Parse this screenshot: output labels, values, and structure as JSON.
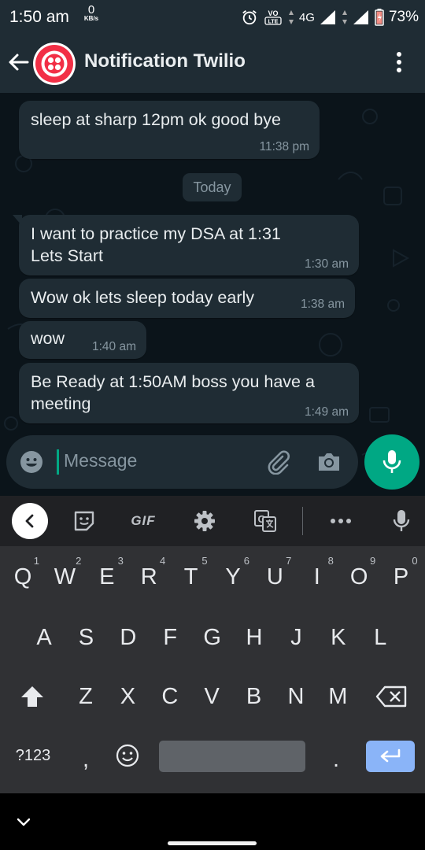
{
  "status_bar": {
    "time": "1:50 am",
    "net_speed_value": "0",
    "net_speed_unit": "KB/s",
    "network": "4G",
    "battery": "73%"
  },
  "header": {
    "title": "Notification Twilio"
  },
  "messages": [
    {
      "text": "sleep at sharp 12pm ok good bye",
      "time": "11:38 pm"
    },
    {
      "text": "I want to practice my DSA at 1:31",
      "text2": "Lets Start",
      "time": "1:30 am"
    },
    {
      "text": "Wow ok lets sleep today early",
      "time": "1:38 am"
    },
    {
      "text": "wow",
      "time": "1:40 am"
    },
    {
      "text": "Be Ready at 1:50AM boss you have a",
      "text2": "meeting",
      "time": "1:49 am"
    }
  ],
  "date_divider": "Today",
  "composer": {
    "placeholder": "Message"
  },
  "keyboard_toolbar": {
    "gif_label": "GIF"
  },
  "keyboard": {
    "row1": [
      [
        "Q",
        "1"
      ],
      [
        "W",
        "2"
      ],
      [
        "E",
        "3"
      ],
      [
        "R",
        "4"
      ],
      [
        "T",
        "5"
      ],
      [
        "Y",
        "6"
      ],
      [
        "U",
        "7"
      ],
      [
        "I",
        "8"
      ],
      [
        "O",
        "9"
      ],
      [
        "P",
        "0"
      ]
    ],
    "row2": [
      "A",
      "S",
      "D",
      "F",
      "G",
      "H",
      "J",
      "K",
      "L"
    ],
    "row3": [
      "Z",
      "X",
      "C",
      "V",
      "B",
      "N",
      "M"
    ],
    "symbols_label": "?123",
    "comma": ",",
    "period": "."
  },
  "colors": {
    "accent": "#00a884",
    "bubble": "#1f2c34",
    "chat_bg": "#0b141a",
    "keyboard_bg": "#303134",
    "enter_key": "#8ab4f8",
    "twilio_red": "#f22f46"
  }
}
